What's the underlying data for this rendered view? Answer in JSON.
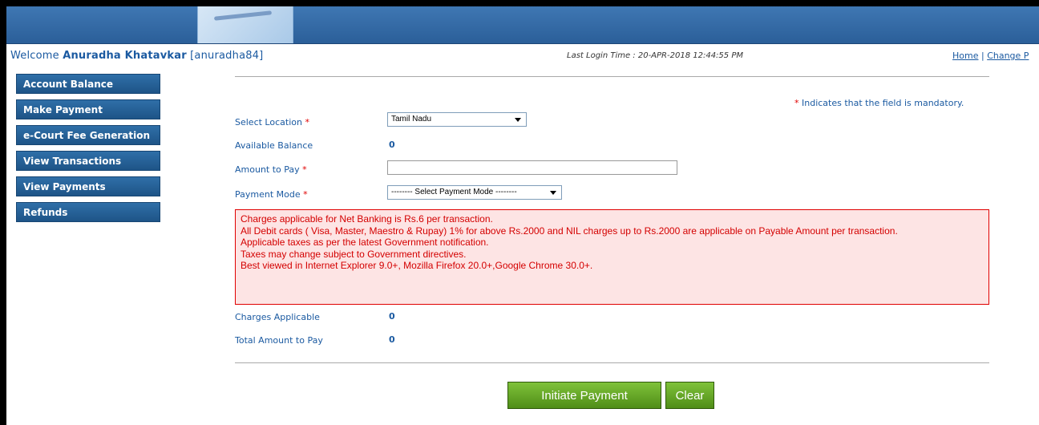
{
  "header": {
    "welcome_prefix": "Welcome ",
    "user_name": "Anuradha Khatavkar",
    "user_id": "[anuradha84]",
    "last_login": "Last Login Time : 20-APR-2018 12:44:55 PM",
    "home_link": "Home",
    "separator": " | ",
    "change_link": "Change P"
  },
  "sidebar": {
    "items": [
      {
        "label": "Account Balance"
      },
      {
        "label": "Make Payment"
      },
      {
        "label": "e-Court Fee Generation"
      },
      {
        "label": "View Transactions"
      },
      {
        "label": "View Payments"
      },
      {
        "label": "Refunds"
      }
    ]
  },
  "form": {
    "mandatory_note": "Indicates that the field is mandatory.",
    "star": "*",
    "location_label": "Select Location",
    "location_value": "Tamil Nadu",
    "balance_label": "Available Balance",
    "balance_value": "0",
    "amount_label": "Amount to Pay",
    "amount_value": "",
    "payment_mode_label": "Payment Mode",
    "payment_mode_value": "-------- Select Payment Mode --------",
    "charges_label": "Charges Applicable",
    "charges_value": "0",
    "total_label": "Total Amount to Pay",
    "total_value": "0"
  },
  "notice": {
    "lines": [
      "Charges applicable for Net Banking is Rs.6 per transaction.",
      "All Debit cards ( Visa, Master, Maestro & Rupay) 1% for above Rs.2000 and NIL charges up to Rs.2000 are applicable on Payable Amount per transaction.",
      "Applicable taxes as per the latest Government notification.",
      "Taxes may change subject to Government directives.",
      "Best viewed in Internet Explorer 9.0+, Mozilla Firefox 20.0+,Google Chrome 30.0+."
    ]
  },
  "actions": {
    "initiate_label": "Initiate Payment",
    "clear_label": "Clear"
  },
  "colors": {
    "link_blue": "#1b5aa1",
    "sidebar_blue": "#1e5487",
    "notice_red": "#d40000",
    "button_green": "#5fa222"
  }
}
